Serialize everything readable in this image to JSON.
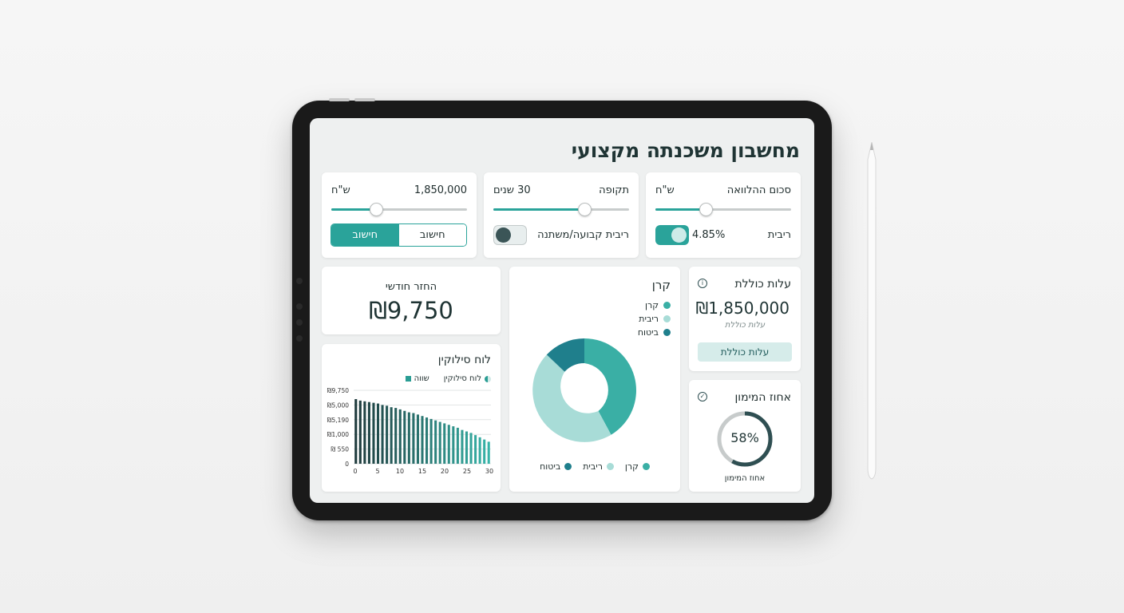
{
  "app": {
    "title": "מחשבון משכנתה מקצועי"
  },
  "loan_card": {
    "label": "סכום ההלוואה",
    "unit": "ש\"ח",
    "slider_fraction": 0.37,
    "rate_label": "ריבית",
    "rate_value": "4.85%",
    "rate_toggle_on": true
  },
  "term_card": {
    "label": "תקופה",
    "value": "30 שנים",
    "slider_fraction": 0.67,
    "rate_type_label": "ריבית קבועה/משתנה",
    "rate_type_toggle_on": false
  },
  "amount_card": {
    "value": "1,850,000",
    "unit": "ש\"ח",
    "slider_fraction": 0.33,
    "seg_options": [
      "חישוב",
      "חישוב"
    ],
    "seg_active": 1
  },
  "monthly_card": {
    "label": "החזר חודשי",
    "value": "₪9,750"
  },
  "donut_card": {
    "title": "קרן",
    "legend": [
      {
        "label": "קרן",
        "color": "#3aafa5"
      },
      {
        "label": "ריבית",
        "color": "#a8dcd7"
      },
      {
        "label": "ביטוח",
        "color": "#1f7f8c"
      }
    ],
    "bottom_legend": [
      {
        "label": "קרן",
        "color": "#3aafa5"
      },
      {
        "label": "ריבית",
        "color": "#a8dcd7"
      },
      {
        "label": "ביטוח",
        "color": "#1f7f8c"
      }
    ]
  },
  "total_cost_card": {
    "title": "עלות כוללת",
    "value": "₪1,850,000",
    "sub": "עלות כוללת",
    "button": "עלות כוללת"
  },
  "financing_card": {
    "title": "אחוז המימון",
    "value": "58%",
    "fraction": 0.58,
    "sub": "אחוז המימון"
  },
  "chart_data": {
    "type": "bar",
    "title": "לוח סילוקין",
    "legend": [
      {
        "label": "שווה",
        "color": "#2a9d94"
      },
      {
        "label": "לוח סילוקין",
        "color": "#2a9d94"
      }
    ],
    "y_ticks": [
      "₪9,750",
      "₪5,000",
      "₪5,190",
      "₪1,000",
      "₪ 550",
      "0"
    ],
    "x_ticks": [
      "0",
      "5",
      "10",
      "15",
      "20",
      "25",
      "30"
    ],
    "x": [
      0,
      1,
      2,
      3,
      4,
      5,
      6,
      7,
      8,
      9,
      10,
      11,
      12,
      13,
      14,
      15,
      16,
      17,
      18,
      19,
      20,
      21,
      22,
      23,
      24,
      25,
      26,
      27,
      28,
      29,
      30
    ],
    "values": [
      88,
      86,
      85,
      84,
      83,
      82,
      80,
      79,
      77,
      76,
      74,
      72,
      70,
      69,
      67,
      65,
      63,
      61,
      59,
      57,
      55,
      53,
      51,
      49,
      46,
      44,
      42,
      39,
      36,
      33,
      30
    ],
    "ylim": [
      0,
      100
    ],
    "colors": {
      "start": "#1e3a3c",
      "end": "#37b3a8"
    }
  },
  "colors": {
    "accent": "#2aa39a",
    "dark": "#2f4f52",
    "light_accent": "#d6ecea"
  }
}
